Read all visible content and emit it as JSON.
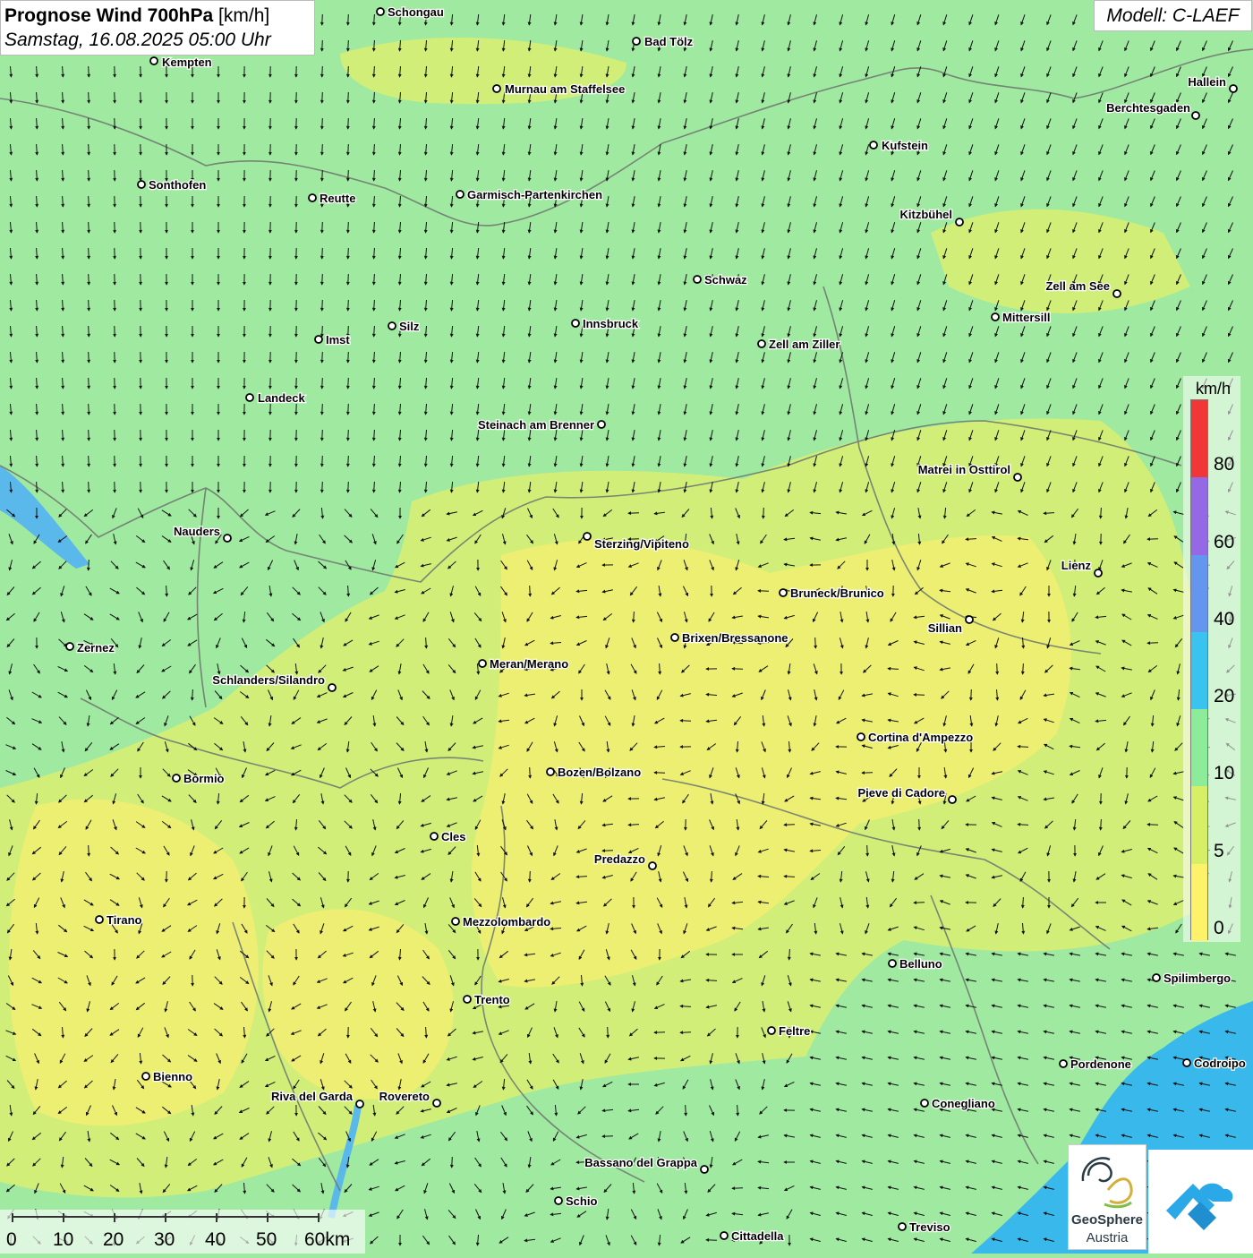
{
  "header": {
    "title_bold": "Prognose Wind 700hPa",
    "title_unit": "[km/h]",
    "datetime": "Samstag, 16.08.2025 05:00 Uhr",
    "model": "Modell: C-LAEF"
  },
  "legend": {
    "unit": "km/h",
    "labels": [
      "80",
      "60",
      "40",
      "20",
      "10",
      "5",
      "0"
    ],
    "bins": [
      0,
      5,
      10,
      20,
      40,
      60,
      80
    ],
    "colors": [
      "#fff26b",
      "#d6ef66",
      "#8cec9a",
      "#39c3ee",
      "#6496f0",
      "#9569e6",
      "#f03636"
    ]
  },
  "scale_bar": {
    "labels": [
      "0",
      "10",
      "20",
      "30",
      "40",
      "50",
      "60km"
    ]
  },
  "logo": {
    "line1": "GeoSphere",
    "line2": "Austria"
  },
  "colors": {
    "sea": "#39b8ec",
    "lake": "#5ab8ea",
    "border": "#707a70"
  },
  "cities": [
    {
      "name": "Schongau"
    },
    {
      "name": "Bad Tölz"
    },
    {
      "name": "Kempten"
    },
    {
      "name": "Murnau am Staffelsee"
    },
    {
      "name": "Hallein"
    },
    {
      "name": "Berchtesgaden"
    },
    {
      "name": "Kufstein"
    },
    {
      "name": "Sonthofen"
    },
    {
      "name": "Reutte"
    },
    {
      "name": "Garmisch-Partenkirchen"
    },
    {
      "name": "Kitzbühel"
    },
    {
      "name": "Schwaz"
    },
    {
      "name": "Zell am See"
    },
    {
      "name": "Mittersill"
    },
    {
      "name": "Silz"
    },
    {
      "name": "Innsbruck"
    },
    {
      "name": "Imst"
    },
    {
      "name": "Zell am Ziller"
    },
    {
      "name": "Landeck"
    },
    {
      "name": "Steinach am Brenner"
    },
    {
      "name": "Matrei in Osttirol"
    },
    {
      "name": "Nauders"
    },
    {
      "name": "Sterzing/Vipiteno"
    },
    {
      "name": "Lienz"
    },
    {
      "name": "Bruneck/Brunico"
    },
    {
      "name": "Sillian"
    },
    {
      "name": "Brixen/Bressanone"
    },
    {
      "name": "Zernez"
    },
    {
      "name": "Meran/Merano"
    },
    {
      "name": "Schlanders/Silandro"
    },
    {
      "name": "Cortina d'Ampezzo"
    },
    {
      "name": "Bozen/Bolzano"
    },
    {
      "name": "Bormio"
    },
    {
      "name": "Pieve di Cadore"
    },
    {
      "name": "Cles"
    },
    {
      "name": "Predazzo"
    },
    {
      "name": "Tirano"
    },
    {
      "name": "Mezzolombardo"
    },
    {
      "name": "Belluno"
    },
    {
      "name": "Spilimbergo"
    },
    {
      "name": "Trento"
    },
    {
      "name": "Feltre"
    },
    {
      "name": "Pordenone"
    },
    {
      "name": "Codroipo"
    },
    {
      "name": "Bienno"
    },
    {
      "name": "Riva del Garda"
    },
    {
      "name": "Rovereto"
    },
    {
      "name": "Conegliano"
    },
    {
      "name": "Bassano del Grappa"
    },
    {
      "name": "Schio"
    },
    {
      "name": "Treviso"
    },
    {
      "name": "Cittadella"
    }
  ]
}
